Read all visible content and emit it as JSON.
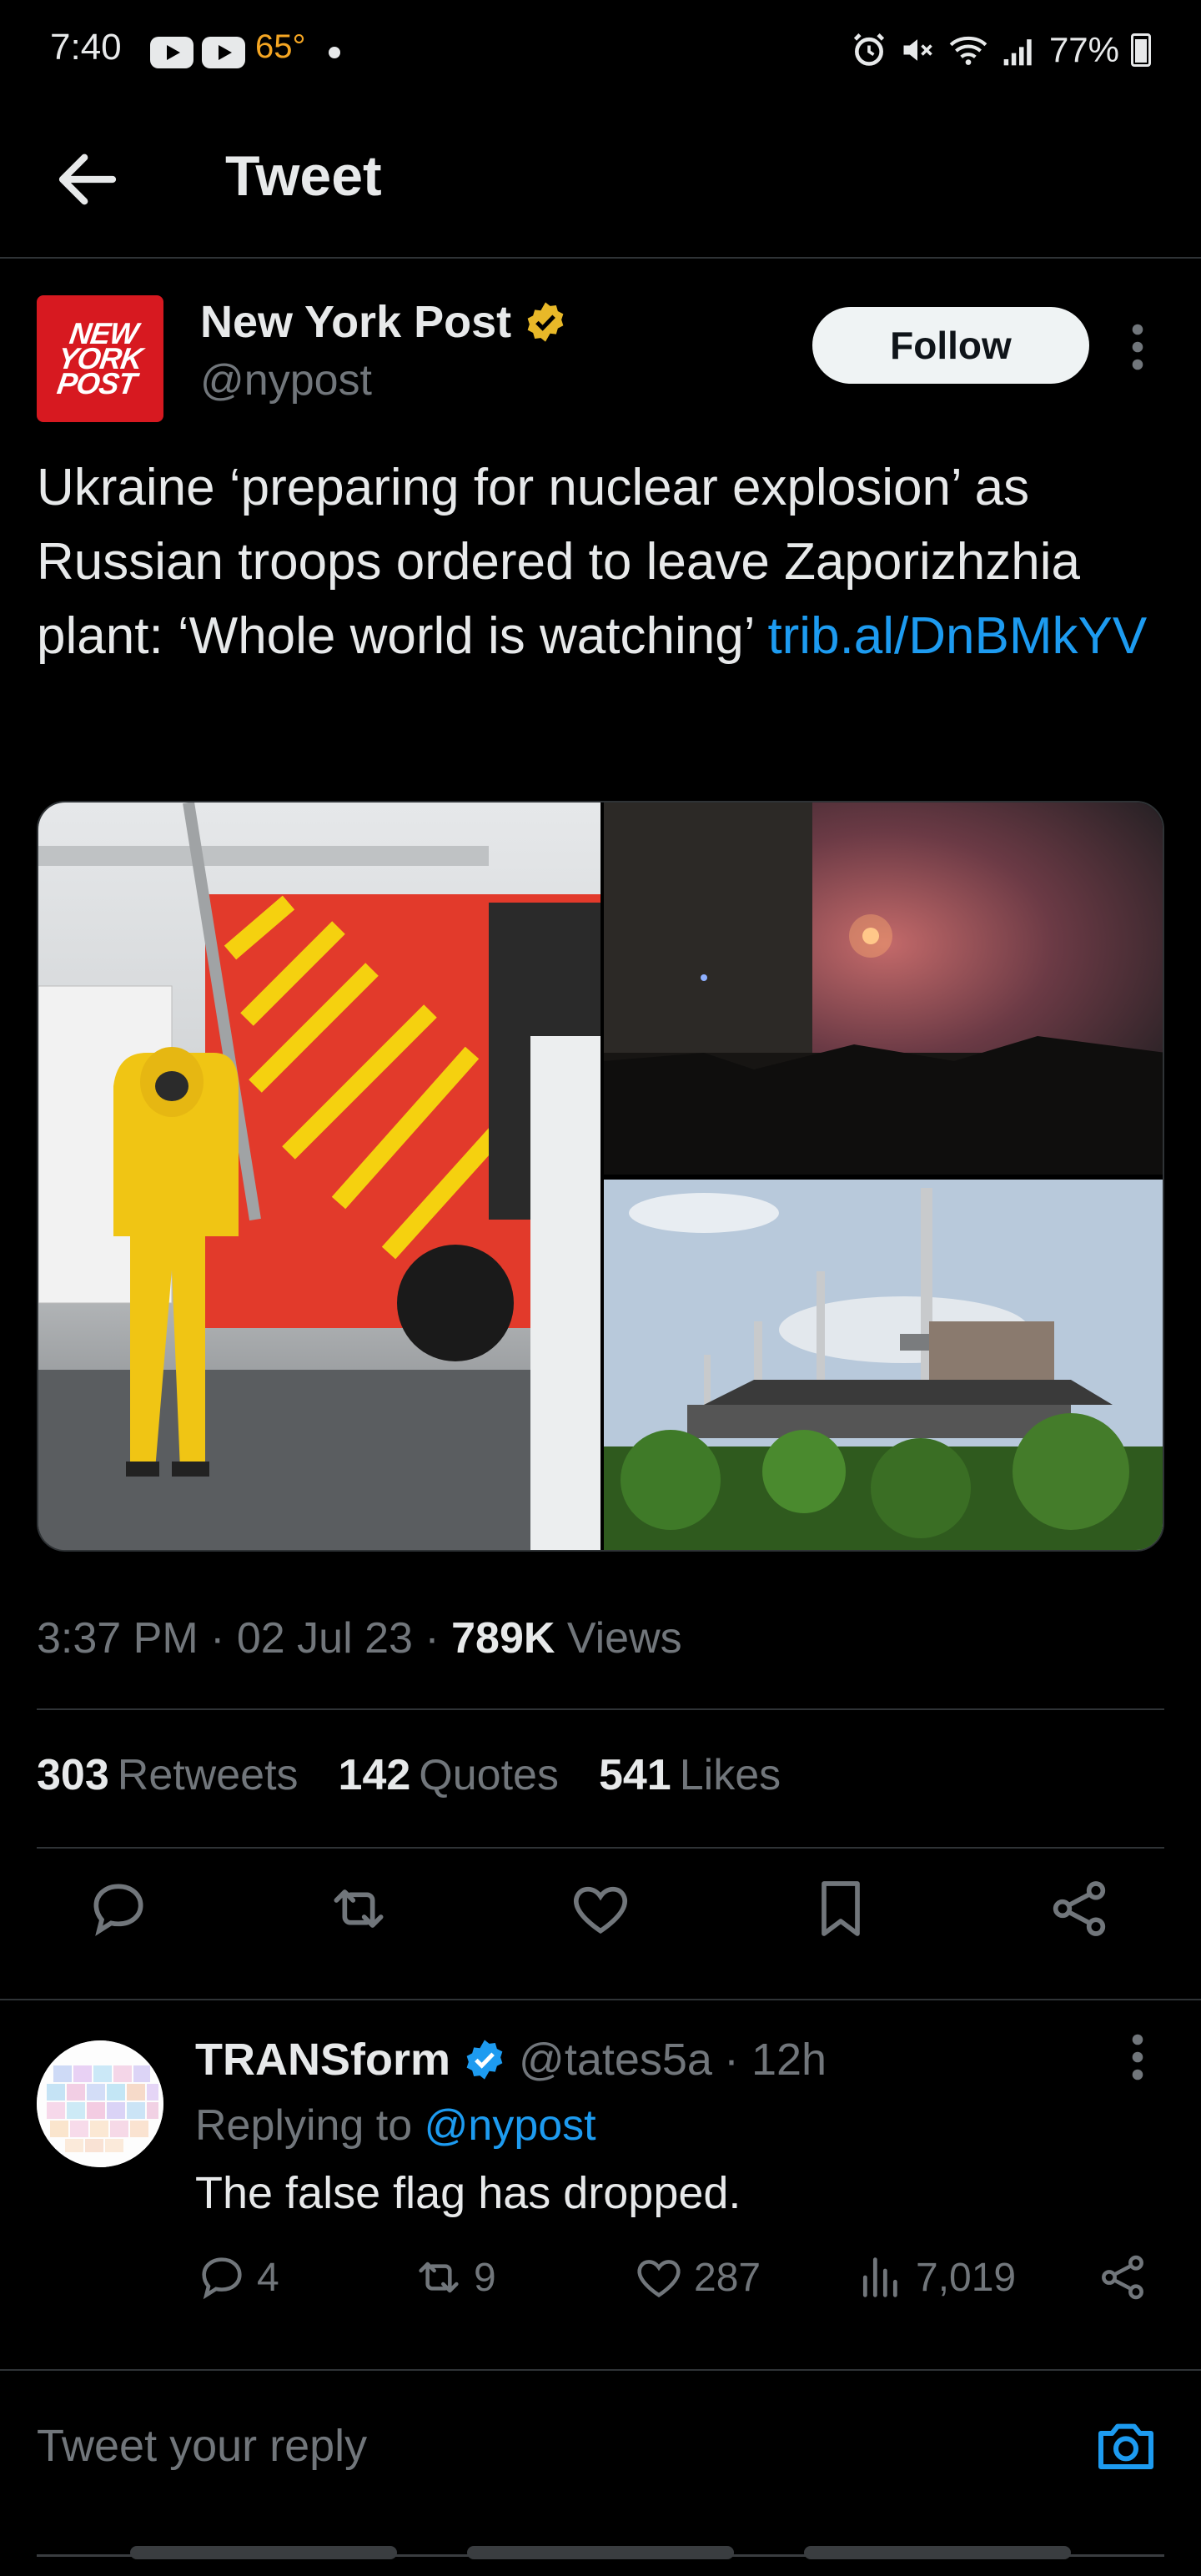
{
  "status_bar": {
    "time": "7:40",
    "temperature": "65°",
    "battery": "77%",
    "icons": [
      "youtube-icon",
      "youtube-icon",
      "alarm-icon",
      "mute-icon",
      "wifi-icon",
      "signal-icon",
      "battery-icon"
    ]
  },
  "header": {
    "title": "Tweet",
    "back_icon": "arrow-left-icon"
  },
  "tweet": {
    "avatar_text": "NEW YORK POST",
    "author_name": "New York Post",
    "author_handle": "@nypost",
    "verified_color": "#e8b828",
    "follow_label": "Follow",
    "text": "Ukraine ‘preparing for nuclear explosion’ as Russian troops ordered to leave Zaporizhzhia plant: ‘Whole world is watching’",
    "link": "trib.al/DnBMkYV",
    "link_color": "#1d9bf0",
    "timestamp": "3:37 PM · 02 Jul 23 · ",
    "views_count": "789K",
    "views_label": " Views",
    "stats": {
      "retweets_count": "303",
      "retweets_label": "Retweets",
      "quotes_count": "142",
      "quotes_label": "Quotes",
      "likes_count": "541",
      "likes_label": "Likes"
    },
    "actions": [
      "reply-icon",
      "retweet-icon",
      "like-icon",
      "bookmark-icon",
      "share-icon"
    ]
  },
  "reply": {
    "author_name": "TRANSform",
    "author_handle": "@tates5a",
    "time": "· 12h",
    "verified_color": "#1d9bf0",
    "replying_to_label": "Replying to ",
    "replying_to_handle": "@nypost",
    "text": "The false flag has dropped.",
    "reply_count": "4",
    "retweet_count": "9",
    "like_count": "287",
    "views_count": "7,019"
  },
  "composer": {
    "placeholder": "Tweet your reply"
  },
  "colors": {
    "background": "#000000",
    "text_primary": "#e7e9ea",
    "text_secondary": "#71767b",
    "accent": "#1d9bf0",
    "border": "#2f3336"
  }
}
